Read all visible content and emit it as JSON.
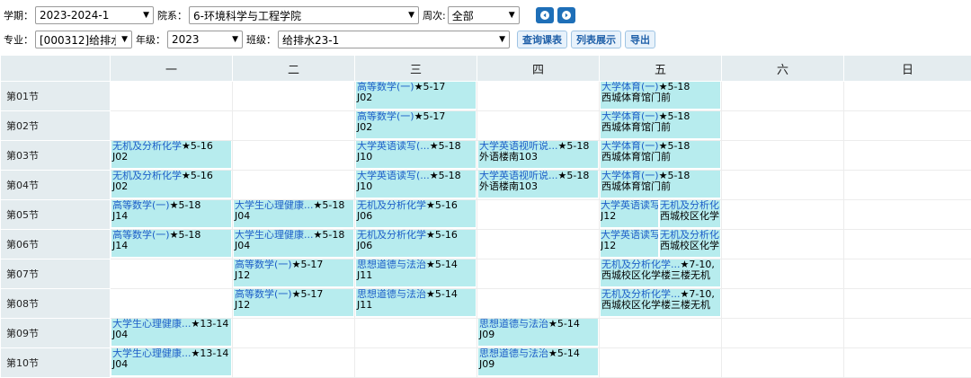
{
  "filters": {
    "term_label": "学期：",
    "term_value": "2023-2024-1",
    "dept_label": "院系：",
    "dept_value": "6-环境科学与工程学院",
    "week_label": "周次:",
    "week_value": "全部",
    "major_label": "专业：",
    "major_value": "[000312]给排水科",
    "grade_label": "年级：",
    "grade_value": "2023",
    "class_label": "班级：",
    "class_value": "给排水23-1",
    "query_button": "查询课表",
    "list_button": "列表展示",
    "export_button": "导出"
  },
  "table": {
    "days": [
      "一",
      "二",
      "三",
      "四",
      "五",
      "六",
      "日"
    ],
    "periods": [
      "第01节",
      "第02节",
      "第03节",
      "第04节",
      "第05节",
      "第06节",
      "第07节",
      "第08节",
      "第09节",
      "第10节"
    ],
    "cells": [
      {
        "p": 0,
        "d": 2,
        "name": "高等数学(一)",
        "weeks": "★5-17",
        "room": "J02"
      },
      {
        "p": 0,
        "d": 4,
        "name": "大学体育(一)",
        "weeks": "★5-18",
        "room": "西城体育馆门前"
      },
      {
        "p": 1,
        "d": 2,
        "name": "高等数学(一)",
        "weeks": "★5-17",
        "room": "J02"
      },
      {
        "p": 1,
        "d": 4,
        "name": "大学体育(一)",
        "weeks": "★5-18",
        "room": "西城体育馆门前"
      },
      {
        "p": 2,
        "d": 0,
        "name": "无机及分析化学",
        "weeks": "★5-16",
        "room": "J02"
      },
      {
        "p": 2,
        "d": 2,
        "name": "大学英语读写(...",
        "weeks": "★5-18",
        "room": "J10"
      },
      {
        "p": 2,
        "d": 3,
        "name": "大学英语视听说...",
        "weeks": "★5-18",
        "room": "外语楼南103"
      },
      {
        "p": 2,
        "d": 4,
        "name": "大学体育(一)",
        "weeks": "★5-18",
        "room": "西城体育馆门前"
      },
      {
        "p": 3,
        "d": 0,
        "name": "无机及分析化学",
        "weeks": "★5-16",
        "room": "J02"
      },
      {
        "p": 3,
        "d": 2,
        "name": "大学英语读写(...",
        "weeks": "★5-18",
        "room": "J10"
      },
      {
        "p": 3,
        "d": 3,
        "name": "大学英语视听说...",
        "weeks": "★5-18",
        "room": "外语楼南103"
      },
      {
        "p": 3,
        "d": 4,
        "name": "大学体育(一)",
        "weeks": "★5-18",
        "room": "西城体育馆门前"
      },
      {
        "p": 4,
        "d": 0,
        "name": "高等数学(一)",
        "weeks": "★5-18",
        "room": "J14"
      },
      {
        "p": 4,
        "d": 1,
        "name": "大学生心理健康...",
        "weeks": "★5-18",
        "room": "J04"
      },
      {
        "p": 4,
        "d": 2,
        "name": "无机及分析化学",
        "weeks": "★5-16",
        "room": "J06"
      },
      {
        "p": 5,
        "d": 0,
        "name": "高等数学(一)",
        "weeks": "★5-18",
        "room": "J14"
      },
      {
        "p": 5,
        "d": 1,
        "name": "大学生心理健康...",
        "weeks": "★5-18",
        "room": "J04"
      },
      {
        "p": 5,
        "d": 2,
        "name": "无机及分析化学",
        "weeks": "★5-16",
        "room": "J06"
      },
      {
        "p": 6,
        "d": 1,
        "name": "高等数学(一)",
        "weeks": "★5-17",
        "room": "J12"
      },
      {
        "p": 6,
        "d": 2,
        "name": "思想道德与法治",
        "weeks": "★5-14",
        "room": "J11"
      },
      {
        "p": 6,
        "d": 4,
        "name": "无机及分析化学...",
        "weeks": "★7-10,",
        "room": "西城校区化学楼三楼无机"
      },
      {
        "p": 7,
        "d": 1,
        "name": "高等数学(一)",
        "weeks": "★5-17",
        "room": "J12"
      },
      {
        "p": 7,
        "d": 2,
        "name": "思想道德与法治",
        "weeks": "★5-14",
        "room": "J11"
      },
      {
        "p": 7,
        "d": 4,
        "name": "无机及分析化学...",
        "weeks": "★7-10,",
        "room": "西城校区化学楼三楼无机"
      },
      {
        "p": 8,
        "d": 0,
        "name": "大学生心理健康...",
        "weeks": "★13-14",
        "room": "J04"
      },
      {
        "p": 8,
        "d": 3,
        "name": "思想道德与法治",
        "weeks": "★5-14",
        "room": "J09"
      },
      {
        "p": 9,
        "d": 0,
        "name": "大学生心理健康...",
        "weeks": "★13-14",
        "room": "J04"
      },
      {
        "p": 9,
        "d": 3,
        "name": "思想道德与法治",
        "weeks": "★5-14",
        "room": "J09"
      }
    ],
    "split_cells": [
      {
        "p": 4,
        "d": 4,
        "left_name": "大学英语读写",
        "left_room": "J12",
        "right_name": "无机及分析化",
        "right_room": "西城校区化学"
      },
      {
        "p": 5,
        "d": 4,
        "left_name": "大学英语读写",
        "left_room": "J12",
        "right_name": "无机及分析化",
        "right_room": "西城校区化学"
      }
    ]
  }
}
